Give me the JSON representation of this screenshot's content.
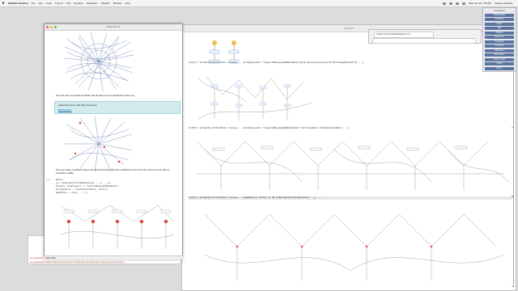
{
  "menubar": {
    "app": "Wolfram Desktop",
    "items": [
      "File",
      "Edit",
      "Insert",
      "Format",
      "Cell",
      "Graphics",
      "Evaluation",
      "Palettes",
      "Window",
      "Help"
    ],
    "clock": "Wed Jan 19 7:55 AM",
    "user": "Stephen Wolfram"
  },
  "browser": {
    "tab_title": "Tweet: test for transformations for m..."
  },
  "palette": {
    "title": "Annotations",
    "buttons": [
      "WolframAlpha",
      "TechNotes",
      "Styles",
      "Tags",
      "Analysis",
      "Reference",
      "Examples",
      "Comments",
      "Markdown",
      "NB Headers",
      "Graph Layout",
      "Styling",
      "Export"
    ]
  },
  "back": {
    "title": "Untitled-4",
    "code1": "In[4]:= Graph[#,VertexSize->Large,...,GraphLayout->\"LayeredDigraphEmbedding\"]&/@ ResourceFunction[\"MultiwaySystem\"][...]",
    "code2": "In[5]:= Graph[#,VertexSize->Large,...,GraphLayout->\"LayeredDigraphEmbedding\",VertexLabels->Automatic]&/@ {...}",
    "code3": "In[6]:= Graph[#,VertexSize->Large,...,EdgeStyle->Gray] & /@ Subgraph[VertexReplace[...], ..."
  },
  "front": {
    "title": "Draft-123.nb",
    "text1": "Now the law of excluded middle and the law of noncontradiction show up:",
    "box_line1": "Label the points with their theorems:",
    "box_link": "Bibliography",
    "text2": "How are these reached? Here's the shortest path within the entailment cone from the axioms to the law of excluded middle:",
    "in_label": "In[ ]:=",
    "code_lines": [
      "With[{",
      "  {g = Subgraph[VertexReplace[eg, ...], ...]},",
      "  Graph[g, GraphLayout -> \"LayeredDigraphEmbedding\",",
      "   VertexLabels -> Placed[Automatic, Center],",
      "   EdgeStyle -> Gray, ...] ]"
    ],
    "status": "Draft 100%"
  },
  "messages": [
    "An unexpected formatted output was encountered. The left-hand side of the option was not a symbol or string.",
    "An unexpected formatted output was encountered. The left-hand side of the option was not a symbol or string."
  ]
}
